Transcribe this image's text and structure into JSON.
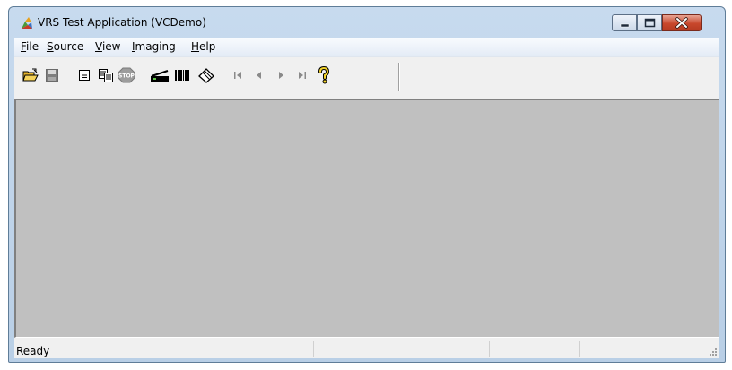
{
  "window": {
    "title": "VRS Test Application (VCDemo)",
    "icon": "vrs-app-icon"
  },
  "caption_buttons": [
    "minimize-icon",
    "maximize-icon",
    "close-icon"
  ],
  "menu": {
    "items": [
      {
        "label": "File",
        "mnemonic": "F",
        "rest": "ile"
      },
      {
        "label": "Source",
        "mnemonic": "S",
        "rest": "ource"
      },
      {
        "label": "View",
        "mnemonic": "V",
        "rest": "iew"
      },
      {
        "label": "Imaging",
        "mnemonic": "I",
        "rest": "maging"
      },
      {
        "label": "Help",
        "mnemonic": "H",
        "rest": "elp"
      }
    ]
  },
  "toolbar": {
    "buttons": [
      {
        "icon": "open-folder-icon",
        "enabled": true
      },
      {
        "icon": "save-disk-icon",
        "enabled": false
      },
      {
        "icon": "properties-icon",
        "enabled": true
      },
      {
        "icon": "copy-icon",
        "enabled": true
      },
      {
        "icon": "stop-icon",
        "label": "STOP",
        "enabled": false
      },
      {
        "icon": "scanner-icon",
        "enabled": true
      },
      {
        "icon": "barcode-icon",
        "enabled": true
      },
      {
        "icon": "eraser-icon",
        "enabled": true
      },
      {
        "icon": "first-page-icon",
        "enabled": false
      },
      {
        "icon": "previous-page-icon",
        "enabled": false
      },
      {
        "icon": "next-page-icon",
        "enabled": false
      },
      {
        "icon": "last-page-icon",
        "enabled": false
      },
      {
        "icon": "help-icon",
        "enabled": true
      }
    ]
  },
  "status": {
    "text": "Ready"
  },
  "colors": {
    "workspace": "#c0c0c0",
    "chrome": "#f0f0f0",
    "titlebar": "#c7daee",
    "close": "#c8472c"
  }
}
